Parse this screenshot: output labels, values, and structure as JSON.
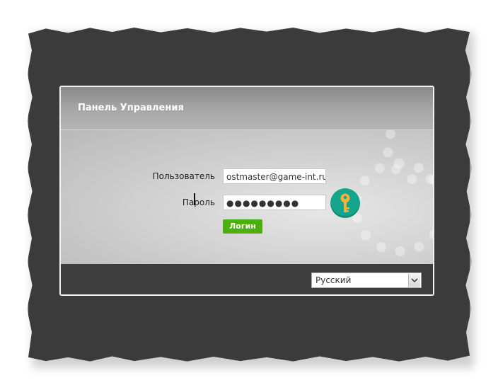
{
  "panel": {
    "title": "Панель Управления"
  },
  "form": {
    "username_label": "Пользователь",
    "username_value": "ostmaster@game-int.ru",
    "password_label": "Пароль",
    "password_value": "●●●●●●●●●",
    "login_button": "Логин"
  },
  "footer": {
    "language_selected": "Русский"
  },
  "icons": {
    "key": "key-icon",
    "select_arrow": "chevron-down-icon"
  },
  "colors": {
    "button": "#4caf0f",
    "key_badge": "#15a58d",
    "key": "#f0b13a"
  }
}
